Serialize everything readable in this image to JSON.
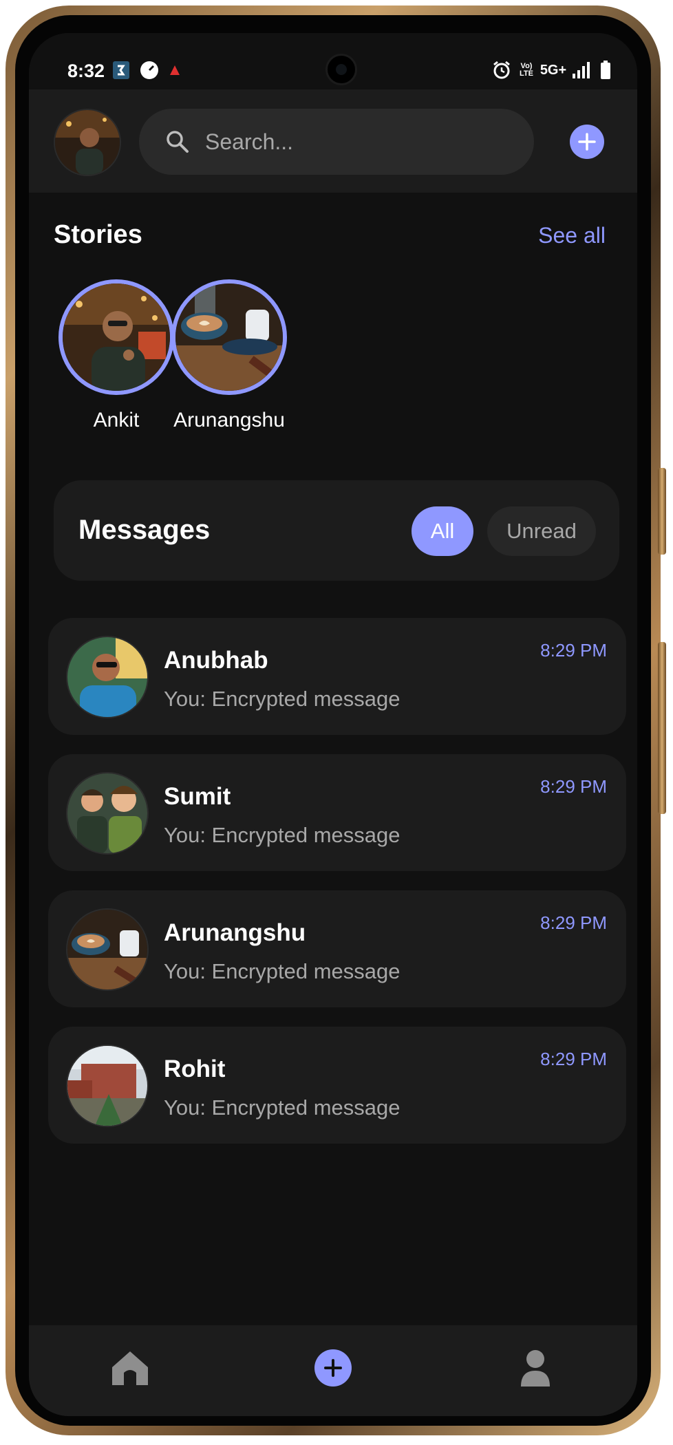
{
  "status_bar": {
    "time": "8:32",
    "network": "5G+",
    "volte": "Vo) LTE"
  },
  "header": {
    "search_placeholder": "Search..."
  },
  "stories": {
    "title": "Stories",
    "see_all": "See all",
    "items": [
      {
        "name": "Ankit"
      },
      {
        "name": "Arunangshu"
      }
    ]
  },
  "messages": {
    "title": "Messages",
    "filters": {
      "all": "All",
      "unread": "Unread"
    },
    "selected_filter": "All",
    "chats": [
      {
        "name": "Anubhab",
        "preview": "You: Encrypted message",
        "time": "8:29 PM"
      },
      {
        "name": "Sumit",
        "preview": "You: Encrypted message",
        "time": "8:29 PM"
      },
      {
        "name": "Arunangshu",
        "preview": "You: Encrypted message",
        "time": "8:29 PM"
      },
      {
        "name": "Rohit",
        "preview": "You: Encrypted message",
        "time": "8:29 PM"
      }
    ]
  },
  "nav": {
    "items": [
      "home-icon",
      "add-icon",
      "profile-icon"
    ]
  },
  "colors": {
    "accent": "#8f98ff",
    "background": "#111111",
    "card": "#1c1c1c",
    "muted_text": "#a8a8a8"
  }
}
